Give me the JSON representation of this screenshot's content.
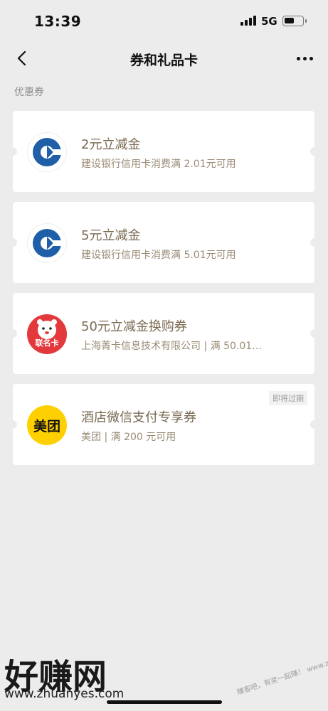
{
  "status_bar": {
    "time": "13:39",
    "network": "5G"
  },
  "nav": {
    "title": "券和礼品卡"
  },
  "section_label": "优惠券",
  "coupons": [
    {
      "title": "2元立减金",
      "desc": "建设银行信用卡消费满 2.01元可用",
      "logo": "ccb-logo-icon"
    },
    {
      "title": "5元立减金",
      "desc": "建设银行信用卡消费满 5.01元可用",
      "logo": "ccb-logo-icon"
    },
    {
      "title": "50元立减金换购券",
      "desc": "上海菁卡信息技术有限公司 | 满 50.01…",
      "logo": "union-card-logo-icon",
      "logo_text": "联名卡"
    },
    {
      "title": "酒店微信支付专享券",
      "desc": "美团 | 满 200 元可用",
      "logo": "meituan-logo-icon",
      "logo_text": "美团",
      "badge": "即将过期"
    }
  ],
  "watermark": {
    "main": "好赚网",
    "url": "www.zhuanyes.com",
    "diagonal": "赚客吧，有奖一起赚！ www.zuanke8.com"
  },
  "colors": {
    "background": "#ececec",
    "coupon_title": "#7a6a52",
    "ccb_blue": "#1f5fa8",
    "union_red": "#e4393c",
    "meituan_yellow": "#ffd000"
  }
}
